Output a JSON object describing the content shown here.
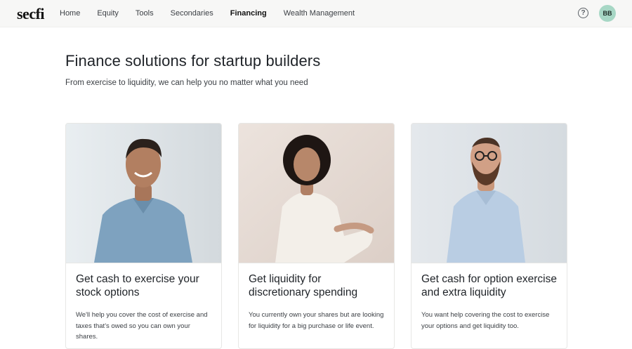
{
  "brand": {
    "logo_text": "secfi"
  },
  "nav": {
    "items": [
      {
        "label": "Home",
        "active": false
      },
      {
        "label": "Equity",
        "active": false
      },
      {
        "label": "Tools",
        "active": false
      },
      {
        "label": "Secondaries",
        "active": false
      },
      {
        "label": "Financing",
        "active": true
      },
      {
        "label": "Wealth Management",
        "active": false
      }
    ],
    "help_icon": "question-circle-icon",
    "avatar_initials": "BB",
    "avatar_color": "#a7d7c5"
  },
  "hero": {
    "title": "Finance solutions for startup builders",
    "subtitle": "From exercise to liquidity, we can help you no matter what you need"
  },
  "cards": [
    {
      "title": "Get cash to exercise your stock options",
      "body": "We'll help you cover the cost of exercise and taxes that's owed so you can own your shares.",
      "photo_bg": "#dfe4e8"
    },
    {
      "title": "Get liquidity for discretionary spending",
      "body": "You currently own your shares but are looking for liquidity for a big purchase or life event.",
      "photo_bg": "#e7dbd4"
    },
    {
      "title": "Get cash for option exercise and extra liquidity",
      "body": "You want help covering the cost to exercise your options and get liquidity too.",
      "photo_bg": "#dfe4e9"
    }
  ]
}
